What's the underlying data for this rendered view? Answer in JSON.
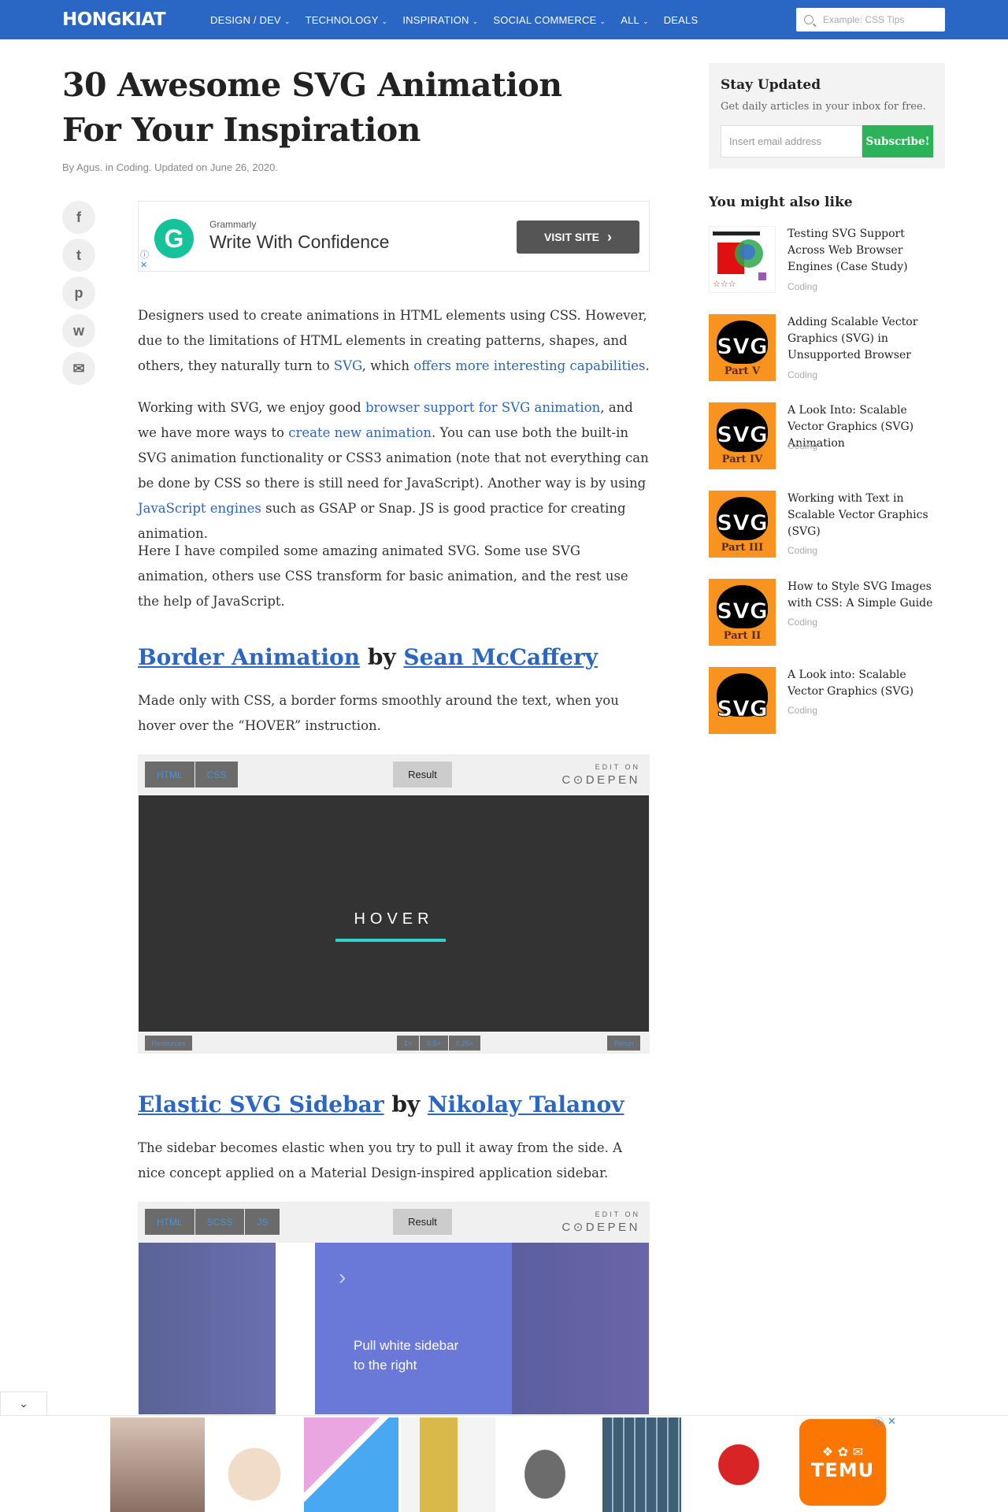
{
  "header": {
    "logo": "HONGKIAT",
    "nav": [
      {
        "label": "DESIGN / DEV",
        "chevron": "⌄"
      },
      {
        "label": "TECHNOLOGY",
        "chevron": "⌄"
      },
      {
        "label": "INSPIRATION",
        "chevron": "⌄"
      },
      {
        "label": "SOCIAL COMMERCE",
        "chevron": "⌄"
      },
      {
        "label": "ALL",
        "chevron": "⌄"
      },
      {
        "label": "DEALS",
        "chevron": ""
      }
    ],
    "search_placeholder": "Example: CSS Tips"
  },
  "article": {
    "title": "30 Awesome SVG Animation For Your Inspiration",
    "byline": "By Agus. in Coding. Updated on June 26, 2020.",
    "share_icons": [
      "facebook-icon",
      "twitter-icon",
      "pinterest-icon",
      "whatsapp-icon",
      "email-icon"
    ],
    "share_glyphs": [
      "f",
      "t",
      "p",
      "w",
      "✉"
    ],
    "ad": {
      "brand": "Grammarly",
      "headline": "Write With Confidence",
      "button": "VISIT SITE",
      "button_icon": "›",
      "logo_letter": "G",
      "info_icon": "ⓘ",
      "close_icon": "✕"
    },
    "p1": {
      "a": "Designers used to create animations in HTML elements using CSS. However, due to the limitations of HTML elements in creating patterns, shapes, and others, they naturally turn to ",
      "link1": "SVG",
      "b": ", which ",
      "link2": "offers more interesting capabilities",
      "c": "."
    },
    "p2": {
      "a": "Working with SVG, we enjoy good ",
      "link1": "browser support for SVG animation",
      "b": ", and we have more ways to ",
      "link2": "create new animation",
      "c": ". You can use both the built-in SVG animation functionality or CSS3 animation (note that not everything can be done by CSS so there is still need for JavaScript). Another way is by using ",
      "link3": "JavaScript engines",
      "d": " such as GSAP or Snap. JS is good practice for creating animation."
    },
    "p3": "Here I have compiled some amazing animated SVG. Some use SVG animation, others use CSS transform for basic animation, and the rest use the help of JavaScript.",
    "sections": [
      {
        "title_link": "Border Animation",
        "by": " by ",
        "author_link": "Sean McCaffery",
        "desc": "Made only with CSS, a border forms smoothly around the text, when you hover over the “HOVER” instruction.",
        "tabs": [
          "HTML",
          "CSS"
        ],
        "result": "Result",
        "edit_small": "EDIT ON",
        "edit_big": "C⊙DEPEN",
        "stage_text": "HOVER",
        "footer": [
          "Resources",
          "1×",
          "0.5×",
          "0.25×",
          "Rerun"
        ]
      },
      {
        "title_link": "Elastic SVG Sidebar",
        "by": " by ",
        "author_link": "Nikolay Talanov",
        "desc": "The sidebar becomes elastic when you try to pull it away from the side. A nice concept applied on a Material Design-inspired application sidebar.",
        "tabs": [
          "HTML",
          "SCSS",
          "JS"
        ],
        "result": "Result",
        "edit_small": "EDIT ON",
        "edit_big": "C⊙DEPEN",
        "stage_text": "Pull white sidebar to the right",
        "chevron": "›"
      }
    ]
  },
  "sidebar": {
    "stay_title": "Stay Updated",
    "stay_sub": "Get daily articles in your inbox for free.",
    "email_placeholder": "Insert email address",
    "subscribe": "Subscribe!",
    "yml_title": "You might also like",
    "related": [
      {
        "title": "Testing SVG Support Across Web Browser Engines (Case Study)",
        "category": "Coding",
        "badge": ""
      },
      {
        "title": "Adding Scalable Vector Graphics (SVG) in Unsupported Browser",
        "category": "Coding",
        "badge": "Part V"
      },
      {
        "title": "A Look Into: Scalable Vector Graphics (SVG) Animation",
        "category": "Coding",
        "badge": "Part IV"
      },
      {
        "title": "Working with Text in Scalable Vector Graphics (SVG)",
        "category": "Coding",
        "badge": "Part III"
      },
      {
        "title": "How to Style SVG Images with CSS: A Simple Guide",
        "category": "Coding",
        "badge": "Part II"
      },
      {
        "title": "A Look into: Scalable Vector Graphics (SVG)",
        "category": "Coding",
        "badge": ""
      }
    ],
    "svg_label": "SVG"
  },
  "bottom_ad": {
    "toggle_icon": "⌄",
    "brand": "TEMU",
    "close_icon": "✕",
    "info_icon": "ⓘ"
  }
}
